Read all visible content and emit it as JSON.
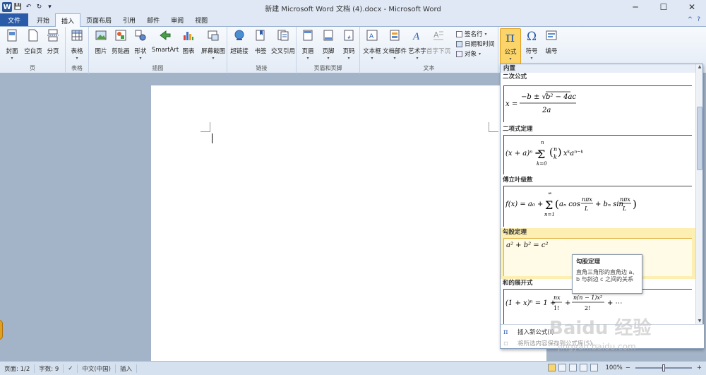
{
  "window": {
    "title": "新建 Microsoft Word 文档 (4).docx - Microsoft Word",
    "app_icon": "W",
    "controls": {
      "minimize": "─",
      "maximize": "☐",
      "close": "✕"
    }
  },
  "qat": {
    "save": "💾",
    "undo": "↶",
    "redo": "↻",
    "customize": "▾"
  },
  "tabs": [
    {
      "label": "文件"
    },
    {
      "label": "开始"
    },
    {
      "label": "插入"
    },
    {
      "label": "页面布局"
    },
    {
      "label": "引用"
    },
    {
      "label": "邮件"
    },
    {
      "label": "审阅"
    },
    {
      "label": "视图"
    }
  ],
  "help": {
    "expand": "^",
    "help": "?"
  },
  "ribbon": {
    "groups": {
      "pages": "页",
      "tables": "表格",
      "illustrations": "插图",
      "links": "链接",
      "header_footer": "页眉和页脚",
      "text": "文本"
    },
    "buttons": {
      "cover": "封面",
      "blank": "空白页",
      "pagebreak": "分页",
      "table": "表格",
      "picture": "图片",
      "clipart": "剪贴画",
      "shapes": "形状",
      "smartart": "SmartArt",
      "chart": "图表",
      "screenshot": "屏幕截图",
      "hyperlink": "超链接",
      "bookmark": "书签",
      "crossref": "交叉引用",
      "header": "页眉",
      "footer": "页脚",
      "pagenum": "页码",
      "textbox": "文本框",
      "quickparts": "文档部件",
      "wordart": "艺术字",
      "dropcap": "首字下沉",
      "signature": "签名行",
      "datetime": "日期和时间",
      "object": "对象",
      "equation": "公式",
      "symbol": "符号",
      "number": "编号"
    }
  },
  "gallery": {
    "header": "内置",
    "items": [
      {
        "title": "二次公式",
        "eq": "x = (−b ± √(b² − 4ac)) / 2a"
      },
      {
        "title": "二项式定理",
        "eq": "(x + a)ⁿ = Σₖ₌₀ⁿ (ⁿₖ) xᵏ aⁿ⁻ᵏ"
      },
      {
        "title": "傅立叶级数",
        "eq": "f(x) = a₀ + Σₙ₌₁^∞ (aₙ cos nπx/L + bₙ sin nπx/L)"
      },
      {
        "title": "勾股定理",
        "eq": "a² + b² = c²"
      },
      {
        "title": "和的展开式",
        "eq": "(1 + x)ⁿ = 1 + nx/1! + n(n − 1)x²/2! + ⋯"
      }
    ],
    "footer": {
      "insert_new": "插入新公式(I)",
      "save_selection": "将所选内容保存到公式库(S)..."
    }
  },
  "tooltip": {
    "title": "勾股定理",
    "body": "直角三角形的直角边 a、b 与斜边 c 之间的关系"
  },
  "statusbar": {
    "page": "页面: 1/2",
    "words": "字数: 9",
    "language": "中文(中国)",
    "mode": "插入",
    "zoom": "100%",
    "zoom_out": "−",
    "zoom_in": "+"
  },
  "watermark": {
    "brand": "Baidu 经验",
    "url": "jingyan.baidu.com"
  },
  "colors": {
    "file_tab": "#2a5ba8",
    "selected": "#fbd46a",
    "hover": "#fdeeb2"
  }
}
